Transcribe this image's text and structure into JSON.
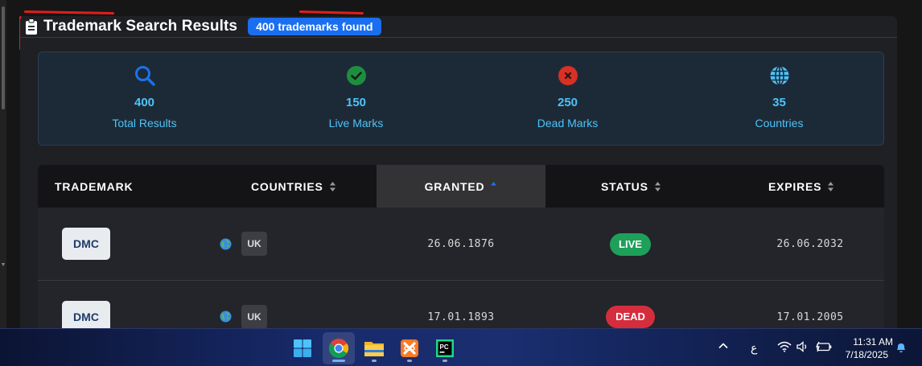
{
  "header": {
    "title": "Trademark Search Results",
    "badge": "400 trademarks found"
  },
  "stats": [
    {
      "value": "400",
      "label": "Total Results",
      "icon": "search-icon",
      "color": "#1a73e8"
    },
    {
      "value": "150",
      "label": "Live Marks",
      "icon": "check-circle-icon",
      "color": "#1e8e3e"
    },
    {
      "value": "250",
      "label": "Dead Marks",
      "icon": "x-circle-icon",
      "color": "#d93025"
    },
    {
      "value": "35",
      "label": "Countries",
      "icon": "globe-icon",
      "color": "#4fc3f7"
    }
  ],
  "table": {
    "columns": [
      "TRADEMARK",
      "COUNTRIES",
      "GRANTED",
      "STATUS",
      "EXPIRES"
    ],
    "sorted_column": "GRANTED",
    "sort_direction": "ascending",
    "rows": [
      {
        "trademark": "DMC",
        "country": "UK",
        "granted": "26.06.1876",
        "status": "LIVE",
        "expires": "26.06.2032"
      },
      {
        "trademark": "DMC",
        "country": "UK",
        "granted": "17.01.1893",
        "status": "DEAD",
        "expires": "17.01.2005"
      }
    ]
  },
  "taskbar": {
    "apps": [
      "start-icon",
      "chrome-icon",
      "file-explorer-icon",
      "xampp-icon",
      "pycharm-icon"
    ],
    "tray": {
      "language": "ع",
      "time": "11:31 AM",
      "date": "7/18/2025"
    }
  },
  "colors": {
    "accent": "#1a6ef0",
    "stat_text": "#4fc3f7",
    "live": "#1fa05a",
    "dead": "#d42e3e"
  }
}
